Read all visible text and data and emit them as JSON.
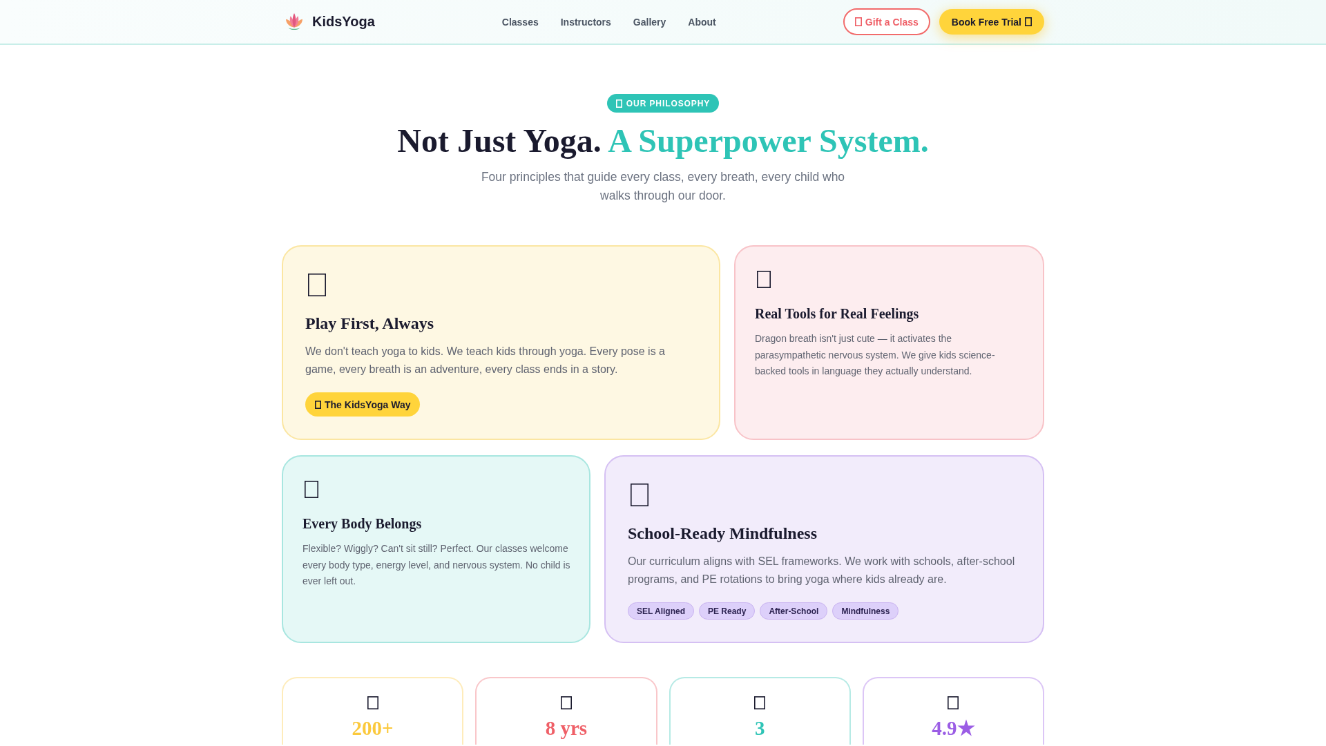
{
  "header": {
    "logo": "KidsYoga",
    "nav": [
      {
        "label": "Classes"
      },
      {
        "label": "Instructors"
      },
      {
        "label": "Gallery"
      },
      {
        "label": "About"
      }
    ],
    "actions": [
      {
        "kind": "outline",
        "label": "Gift a Class"
      },
      {
        "kind": "solid",
        "label": "Book Free Trial"
      }
    ]
  },
  "hero": {
    "badge": "OUR PHILOSOPHY",
    "title": "Not Just Yoga.",
    "title_highlight": "A Superpower System.",
    "subtitle": "Four principles that guide every class, every breath, every child who walks through our door."
  },
  "principles": [
    {
      "kind": "large",
      "color": "#fbe6a2",
      "title": "Play First, Always",
      "text": "We don't teach yoga to kids. We teach kids through yoga. Every pose is a game, every breath is an adventure, every class ends in a story.",
      "button": "The KidsYoga Way"
    },
    {
      "kind": "small",
      "color": "#f8c3c8",
      "title": "Real Tools for Real Feelings",
      "text": "Dragon breath isn't just cute — it activates the parasympathetic nervous system. We give kids science-backed tools in language they actually understand."
    },
    {
      "kind": "small",
      "color": "#a8e6e0",
      "title": "Every Body Belongs",
      "text": "Flexible? Wiggly? Can't sit still? Perfect. Our classes welcome every body type, energy level, and nervous system. No child is ever left out."
    },
    {
      "kind": "large",
      "color": "#d5c0f3",
      "title": "School-Ready Mindfulness",
      "text": "Our curriculum aligns with SEL frameworks. We work with schools, after-school programs, and PE rotations to bring yoga where kids already are.",
      "tags": [
        "SEL Aligned",
        "PE Ready",
        "After-School",
        "Mindfulness"
      ]
    }
  ],
  "stats": [
    {
      "value": "200+",
      "color": "#fbc93d"
    },
    {
      "value": "8 yrs",
      "color": "#ef5f67"
    },
    {
      "value": "3",
      "color": "#2ec4b6"
    },
    {
      "value": "4.9★",
      "color": "#9b5de5"
    }
  ]
}
